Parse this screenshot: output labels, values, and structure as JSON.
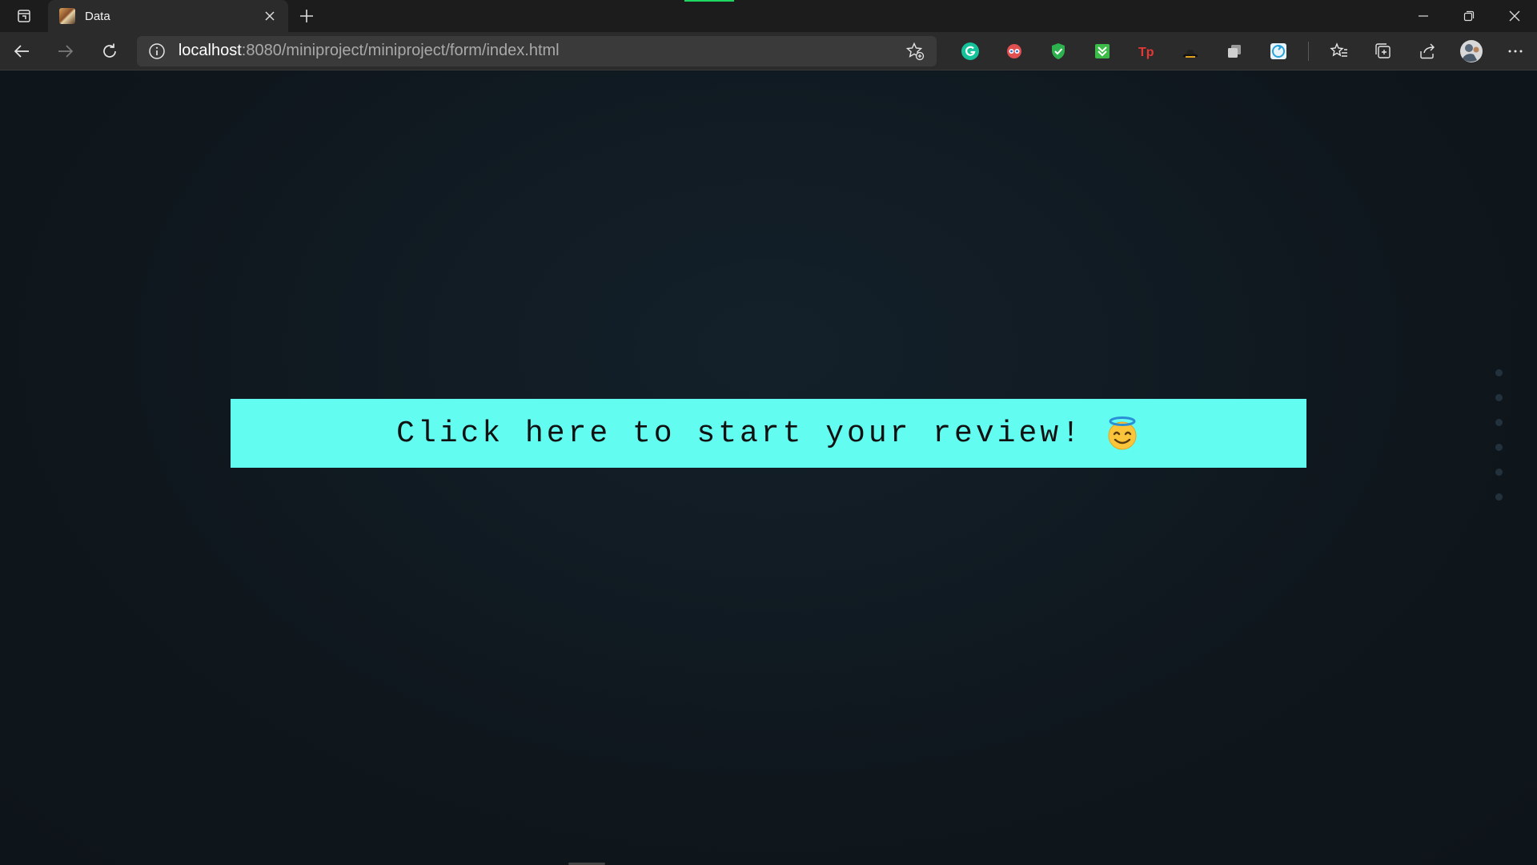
{
  "browser": {
    "tab": {
      "title": "Data"
    },
    "address": {
      "host": "localhost",
      "path": ":8080/miniproject/miniproject/form/index.html"
    },
    "extensions": [
      "grammarly-icon",
      "mask-extension-icon",
      "shield-icon",
      "download-extension-icon",
      "tp-extension-icon",
      "hat-extension-icon",
      "copy-extension-icon",
      "sync-extension-icon"
    ]
  },
  "page": {
    "cta_label": "Click here to start your review!",
    "cta_color": "#62fcf0",
    "emoji": "smiling-face-with-halo"
  }
}
